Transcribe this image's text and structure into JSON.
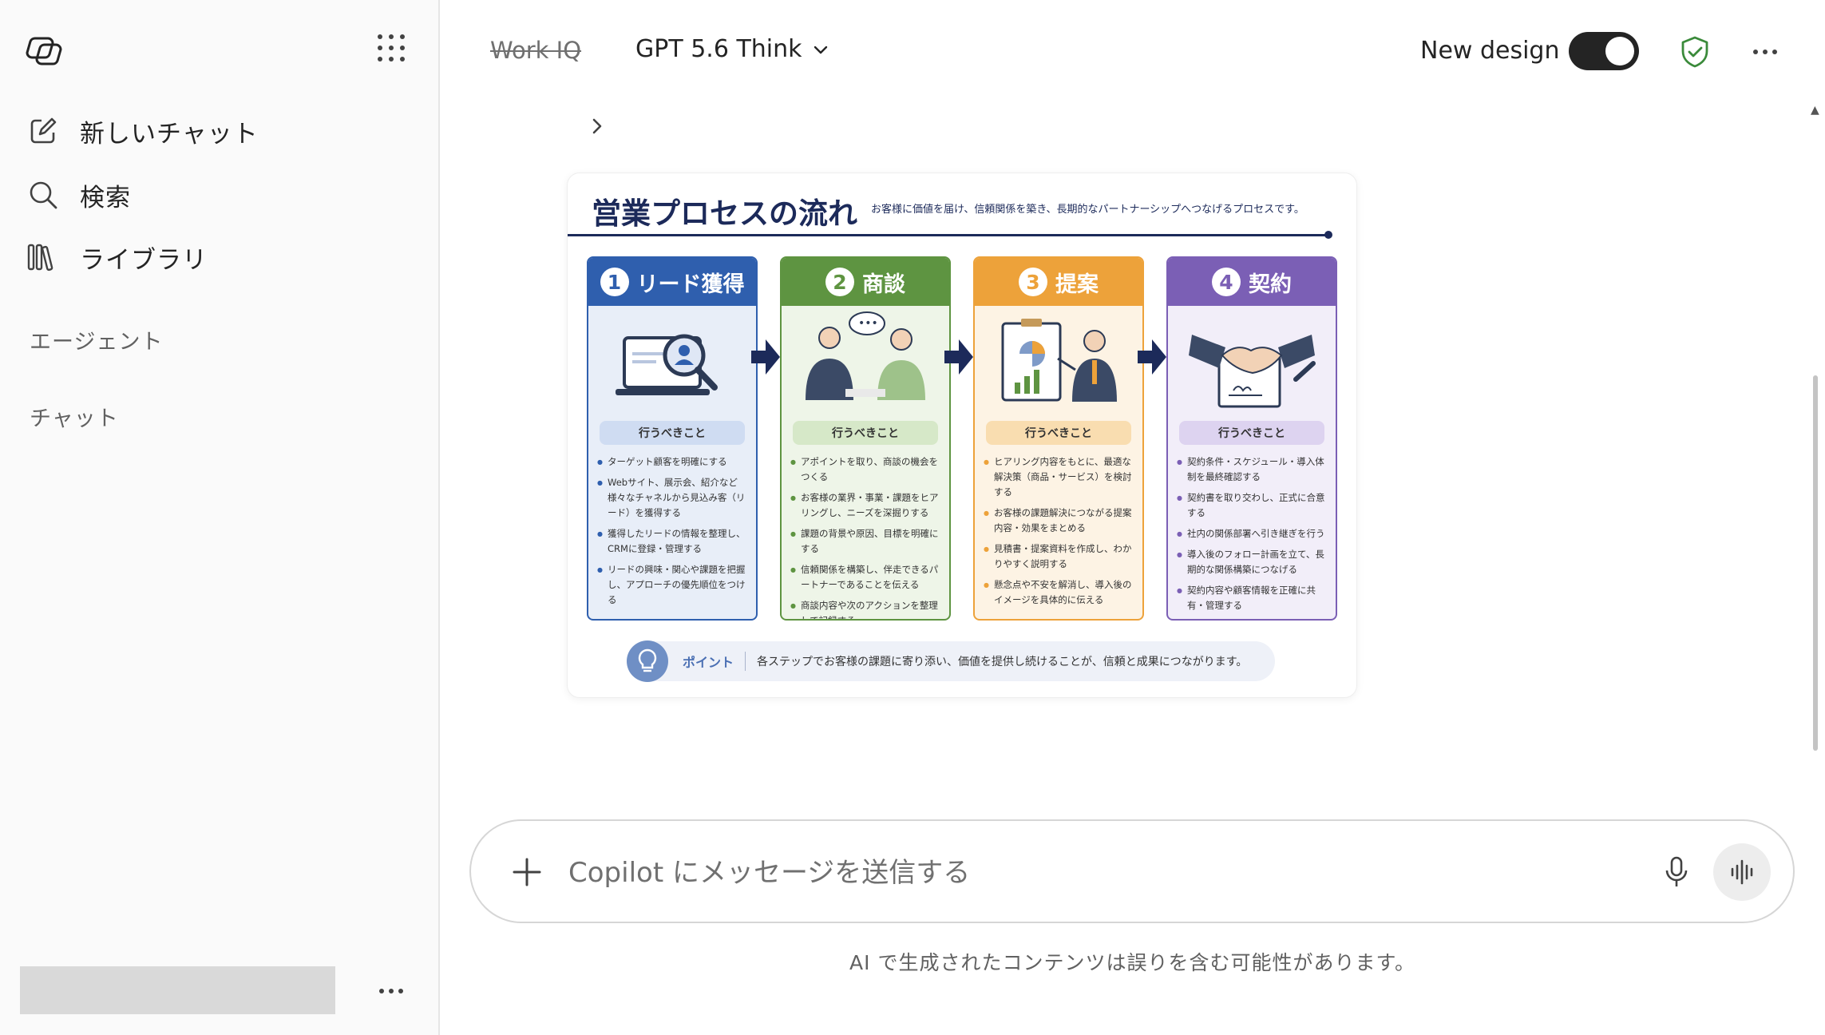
{
  "sidebar": {
    "items": [
      {
        "label": "新しいチャット",
        "icon": "new-chat-icon"
      },
      {
        "label": "検索",
        "icon": "search-icon"
      },
      {
        "label": "ライブラリ",
        "icon": "library-icon"
      }
    ],
    "sections": {
      "agents": "エージェント",
      "chats": "チャット"
    }
  },
  "header": {
    "workiq": "Work IQ",
    "model": "GPT 5.6 Think",
    "new_design_label": "New design",
    "new_design_on": true
  },
  "infographic": {
    "title": "営業プロセスの流れ",
    "subtitle": "お客様に価値を届け、信頼関係を築き、長期的なパートナーシップへつなげるプロセスです。",
    "pill_label": "行うべきこと",
    "steps": [
      {
        "num": "1",
        "title": "リード獲得",
        "color": "#2f5fae",
        "light": "#e8eef8",
        "pill": "#cfdcf2",
        "items": [
          "ターゲット顧客を明確にする",
          "Webサイト、展示会、紹介など様々なチャネルから見込み客（リード）を獲得する",
          "獲得したリードの情報を整理し、CRMに登録・管理する",
          "リードの興味・関心や課題を把握し、アプローチの優先順位をつける"
        ]
      },
      {
        "num": "2",
        "title": "商談",
        "color": "#5e9441",
        "light": "#eef5e8",
        "pill": "#d6e8c8",
        "items": [
          "アポイントを取り、商談の機会をつくる",
          "お客様の業界・事業・課題をヒアリングし、ニーズを深掘りする",
          "課題の背景や原因、目標を明確にする",
          "信頼関係を構築し、伴走できるパートナーであることを伝える",
          "商談内容や次のアクションを整理して記録する"
        ]
      },
      {
        "num": "3",
        "title": "提案",
        "color": "#eda23a",
        "light": "#fdf3e4",
        "pill": "#f9ddb0",
        "items": [
          "ヒアリング内容をもとに、最適な解決策（商品・サービス）を検討する",
          "お客様の課題解決につながる提案内容・効果をまとめる",
          "見積書・提案資料を作成し、わかりやすく説明する",
          "懸念点や不安を解消し、導入後のイメージを具体的に伝える"
        ]
      },
      {
        "num": "4",
        "title": "契約",
        "color": "#7b5fb5",
        "light": "#f2eef9",
        "pill": "#ddd3f0",
        "items": [
          "契約条件・スケジュール・導入体制を最終確認する",
          "契約書を取り交わし、正式に合意する",
          "社内の関係部署へ引き継ぎを行う",
          "導入後のフォロー計画を立て、長期的な関係構築につなげる",
          "契約内容や顧客情報を正確に共有・管理する"
        ]
      }
    ],
    "point": {
      "label": "ポイント",
      "text": "各ステップでお客様の課題に寄り添い、価値を提供し続けることが、信頼と成果につながります。"
    }
  },
  "composer": {
    "placeholder": "Copilot にメッセージを送信する"
  },
  "footer": {
    "disclaimer": "AI で生成されたコンテンツは誤りを含む可能性があります。"
  }
}
